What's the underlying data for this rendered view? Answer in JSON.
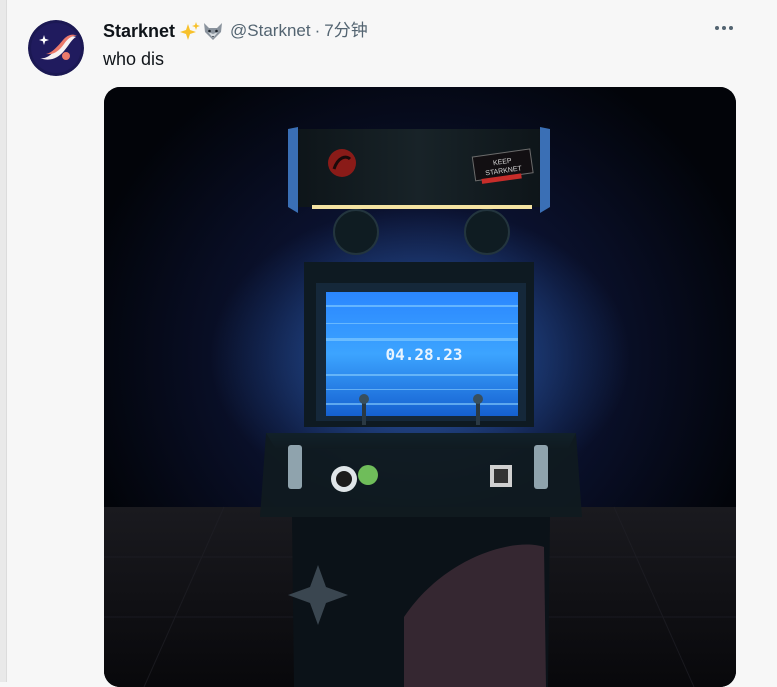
{
  "tweet": {
    "author_name": "Starknet",
    "badge_icons": [
      "sparkles-icon",
      "wolf-icon"
    ],
    "handle": "@Starknet",
    "separator": "·",
    "time": "7分钟",
    "text": "who dis",
    "more_icon": "more-horizontal-icon"
  },
  "media": {
    "screen_text": "04.28.23",
    "marquee_text": [
      "KEEP",
      "STARKNET"
    ]
  },
  "colors": {
    "avatar_bg": "#1f1a5a",
    "screen_glow": "#2a8cff",
    "text_primary": "#0f1419",
    "text_secondary": "#536471"
  }
}
